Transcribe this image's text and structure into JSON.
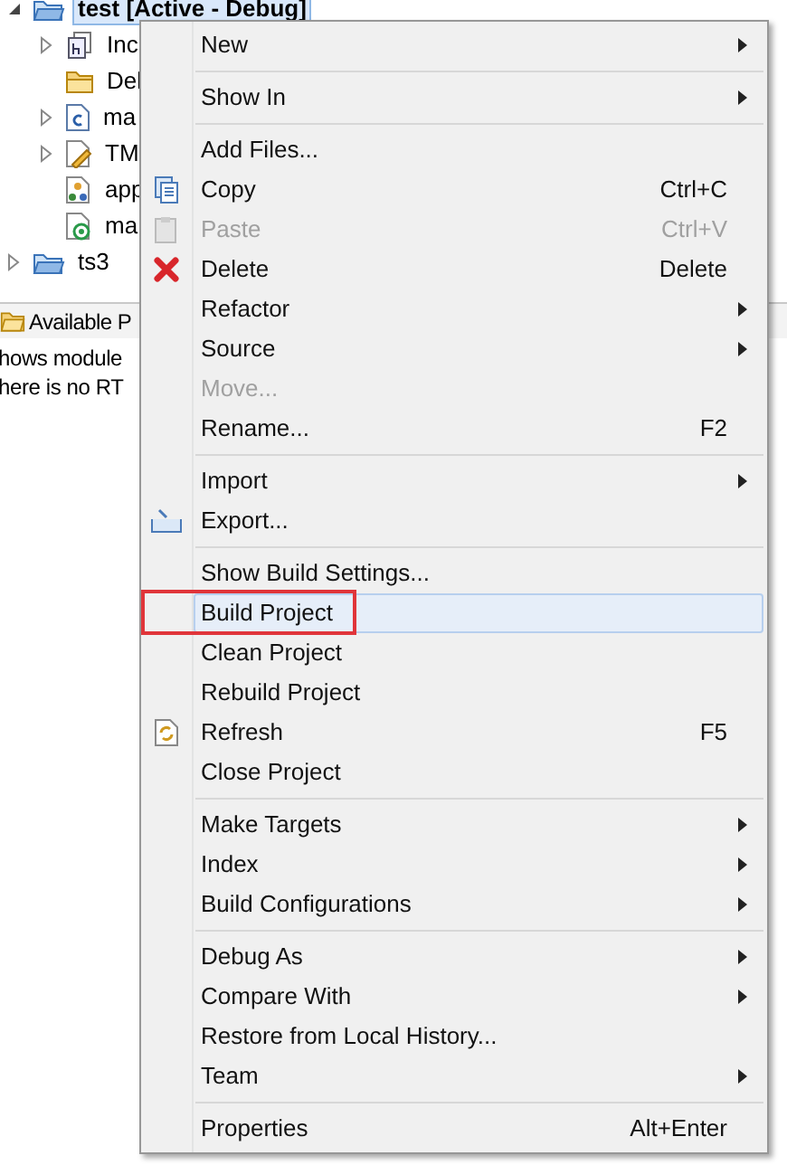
{
  "tree": [
    {
      "label": "test  [Active - Debug]",
      "kind": "project",
      "expanded": true,
      "selected": true,
      "children": [
        {
          "label": "Inc",
          "kind": "includes",
          "expanded": false,
          "selected": false
        },
        {
          "label": "Del",
          "kind": "folder",
          "selected": false
        },
        {
          "label": "ma",
          "kind": "c-file",
          "expanded": false,
          "selected": false
        },
        {
          "label": "TM",
          "kind": "config-file",
          "expanded": false,
          "selected": false
        },
        {
          "label": "app",
          "kind": "app-file",
          "selected": false
        },
        {
          "label": "ma",
          "kind": "target-file",
          "selected": false
        }
      ]
    },
    {
      "label": "ts3",
      "kind": "project",
      "expanded": false,
      "selected": false
    }
  ],
  "panel": {
    "tab": "Available P",
    "lines": [
      "hows module",
      "here is no RT"
    ]
  },
  "menu": {
    "sections": [
      [
        {
          "label": "New",
          "submenu": true,
          "disabled": false,
          "selected": false,
          "marked": false
        }
      ],
      [
        {
          "label": "Show In",
          "submenu": true,
          "disabled": false,
          "selected": false,
          "marked": false
        }
      ],
      [
        {
          "label": "Add Files...",
          "submenu": false,
          "disabled": false,
          "selected": false,
          "marked": false
        },
        {
          "label": "Copy",
          "shortcut": "Ctrl+C",
          "submenu": false,
          "disabled": false,
          "kind": "copy",
          "selected": false,
          "marked": false
        },
        {
          "label": "Paste",
          "shortcut": "Ctrl+V",
          "submenu": false,
          "disabled": true,
          "kind": "paste",
          "selected": false,
          "marked": false
        },
        {
          "label": "Delete",
          "shortcut": "Delete",
          "submenu": false,
          "disabled": false,
          "kind": "delete",
          "selected": false,
          "marked": false
        },
        {
          "label": "Refactor",
          "submenu": true,
          "disabled": false,
          "selected": false,
          "marked": false
        },
        {
          "label": "Source",
          "submenu": true,
          "disabled": false,
          "selected": false,
          "marked": false
        },
        {
          "label": "Move...",
          "submenu": false,
          "disabled": true,
          "selected": false,
          "marked": false
        },
        {
          "label": "Rename...",
          "shortcut": "F2",
          "submenu": false,
          "disabled": false,
          "selected": false,
          "marked": false
        }
      ],
      [
        {
          "label": "Import",
          "submenu": true,
          "disabled": false,
          "selected": false,
          "marked": false
        },
        {
          "label": "Export...",
          "submenu": false,
          "disabled": false,
          "kind": "export",
          "selected": false,
          "marked": false
        }
      ],
      [
        {
          "label": "Show Build Settings...",
          "submenu": false,
          "disabled": false,
          "selected": false,
          "marked": false
        },
        {
          "label": "Build Project",
          "submenu": false,
          "disabled": false,
          "selected": true,
          "marked": true
        },
        {
          "label": "Clean Project",
          "submenu": false,
          "disabled": false,
          "selected": false,
          "marked": false
        },
        {
          "label": "Rebuild Project",
          "submenu": false,
          "disabled": false,
          "selected": false,
          "marked": false
        },
        {
          "label": "Refresh",
          "shortcut": "F5",
          "submenu": false,
          "disabled": false,
          "kind": "refresh",
          "selected": false,
          "marked": false
        },
        {
          "label": "Close Project",
          "submenu": false,
          "disabled": false,
          "selected": false,
          "marked": false
        }
      ],
      [
        {
          "label": "Make Targets",
          "submenu": true,
          "disabled": false,
          "selected": false,
          "marked": false
        },
        {
          "label": "Index",
          "submenu": true,
          "disabled": false,
          "selected": false,
          "marked": false
        },
        {
          "label": "Build Configurations",
          "submenu": true,
          "disabled": false,
          "selected": false,
          "marked": false
        }
      ],
      [
        {
          "label": "Debug As",
          "submenu": true,
          "disabled": false,
          "selected": false,
          "marked": false
        },
        {
          "label": "Compare With",
          "submenu": true,
          "disabled": false,
          "selected": false,
          "marked": false
        },
        {
          "label": "Restore from Local History...",
          "submenu": false,
          "disabled": false,
          "selected": false,
          "marked": false
        },
        {
          "label": "Team",
          "submenu": true,
          "disabled": false,
          "selected": false,
          "marked": false
        }
      ],
      [
        {
          "label": "Properties",
          "shortcut": "Alt+Enter",
          "submenu": false,
          "disabled": false,
          "selected": false,
          "marked": false
        }
      ]
    ]
  }
}
